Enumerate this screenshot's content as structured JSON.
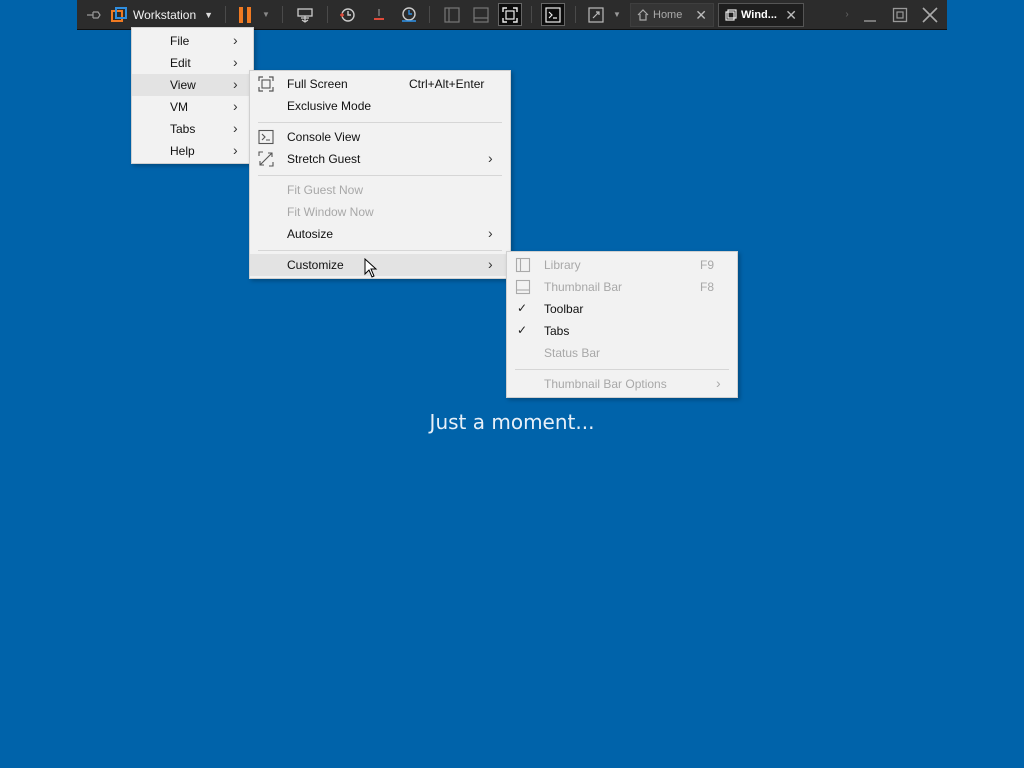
{
  "toolbar": {
    "workstation_label": "Workstation",
    "accent_pause": "#f07a22",
    "icons": [
      "pin-icon",
      "workstation-icon",
      "dropdown-icon",
      "pause-icon",
      "send-keys-icon",
      "snapshot-icon",
      "revert-icon",
      "snapshot-manager-icon",
      "library-icon",
      "thumbnail-icon",
      "fullscreen-icon",
      "console-icon",
      "stretch-icon",
      "minimize-icon",
      "restore-icon",
      "close-icon"
    ],
    "tabs": [
      {
        "label": "Home",
        "active": false
      },
      {
        "label": "Wind...",
        "active": true
      }
    ]
  },
  "main_menu": {
    "items": [
      {
        "label": "File"
      },
      {
        "label": "Edit"
      },
      {
        "label": "View",
        "highlighted": true
      },
      {
        "label": "VM"
      },
      {
        "label": "Tabs"
      },
      {
        "label": "Help"
      }
    ],
    "arrow": "›"
  },
  "view_menu": {
    "items": [
      {
        "label": "Full Screen",
        "shortcut": "Ctrl+Alt+Enter",
        "icon": "fullscreen-icon"
      },
      {
        "label": "Exclusive Mode"
      },
      {
        "label": "Console View",
        "icon": "console-icon"
      },
      {
        "label": "Stretch Guest",
        "icon": "stretch-icon",
        "submenu": true
      },
      {
        "label": "Fit Guest Now",
        "disabled": true
      },
      {
        "label": "Fit Window Now",
        "disabled": true
      },
      {
        "label": "Autosize",
        "submenu": true
      },
      {
        "label": "Customize",
        "submenu": true,
        "highlighted": true
      }
    ]
  },
  "customize_menu": {
    "items": [
      {
        "label": "Library",
        "shortcut": "F9",
        "disabled": true,
        "icon": "library-icon"
      },
      {
        "label": "Thumbnail Bar",
        "shortcut": "F8",
        "disabled": true,
        "icon": "thumbnail-bar-icon"
      },
      {
        "label": "Toolbar",
        "checked": true
      },
      {
        "label": "Tabs",
        "checked": true
      },
      {
        "label": "Status Bar",
        "disabled": true
      },
      {
        "label": "Thumbnail Bar Options",
        "disabled": true,
        "submenu": true
      }
    ],
    "check_glyph": "✓"
  },
  "guest": {
    "status_text": "Just a moment...",
    "background": "#0063aa"
  }
}
